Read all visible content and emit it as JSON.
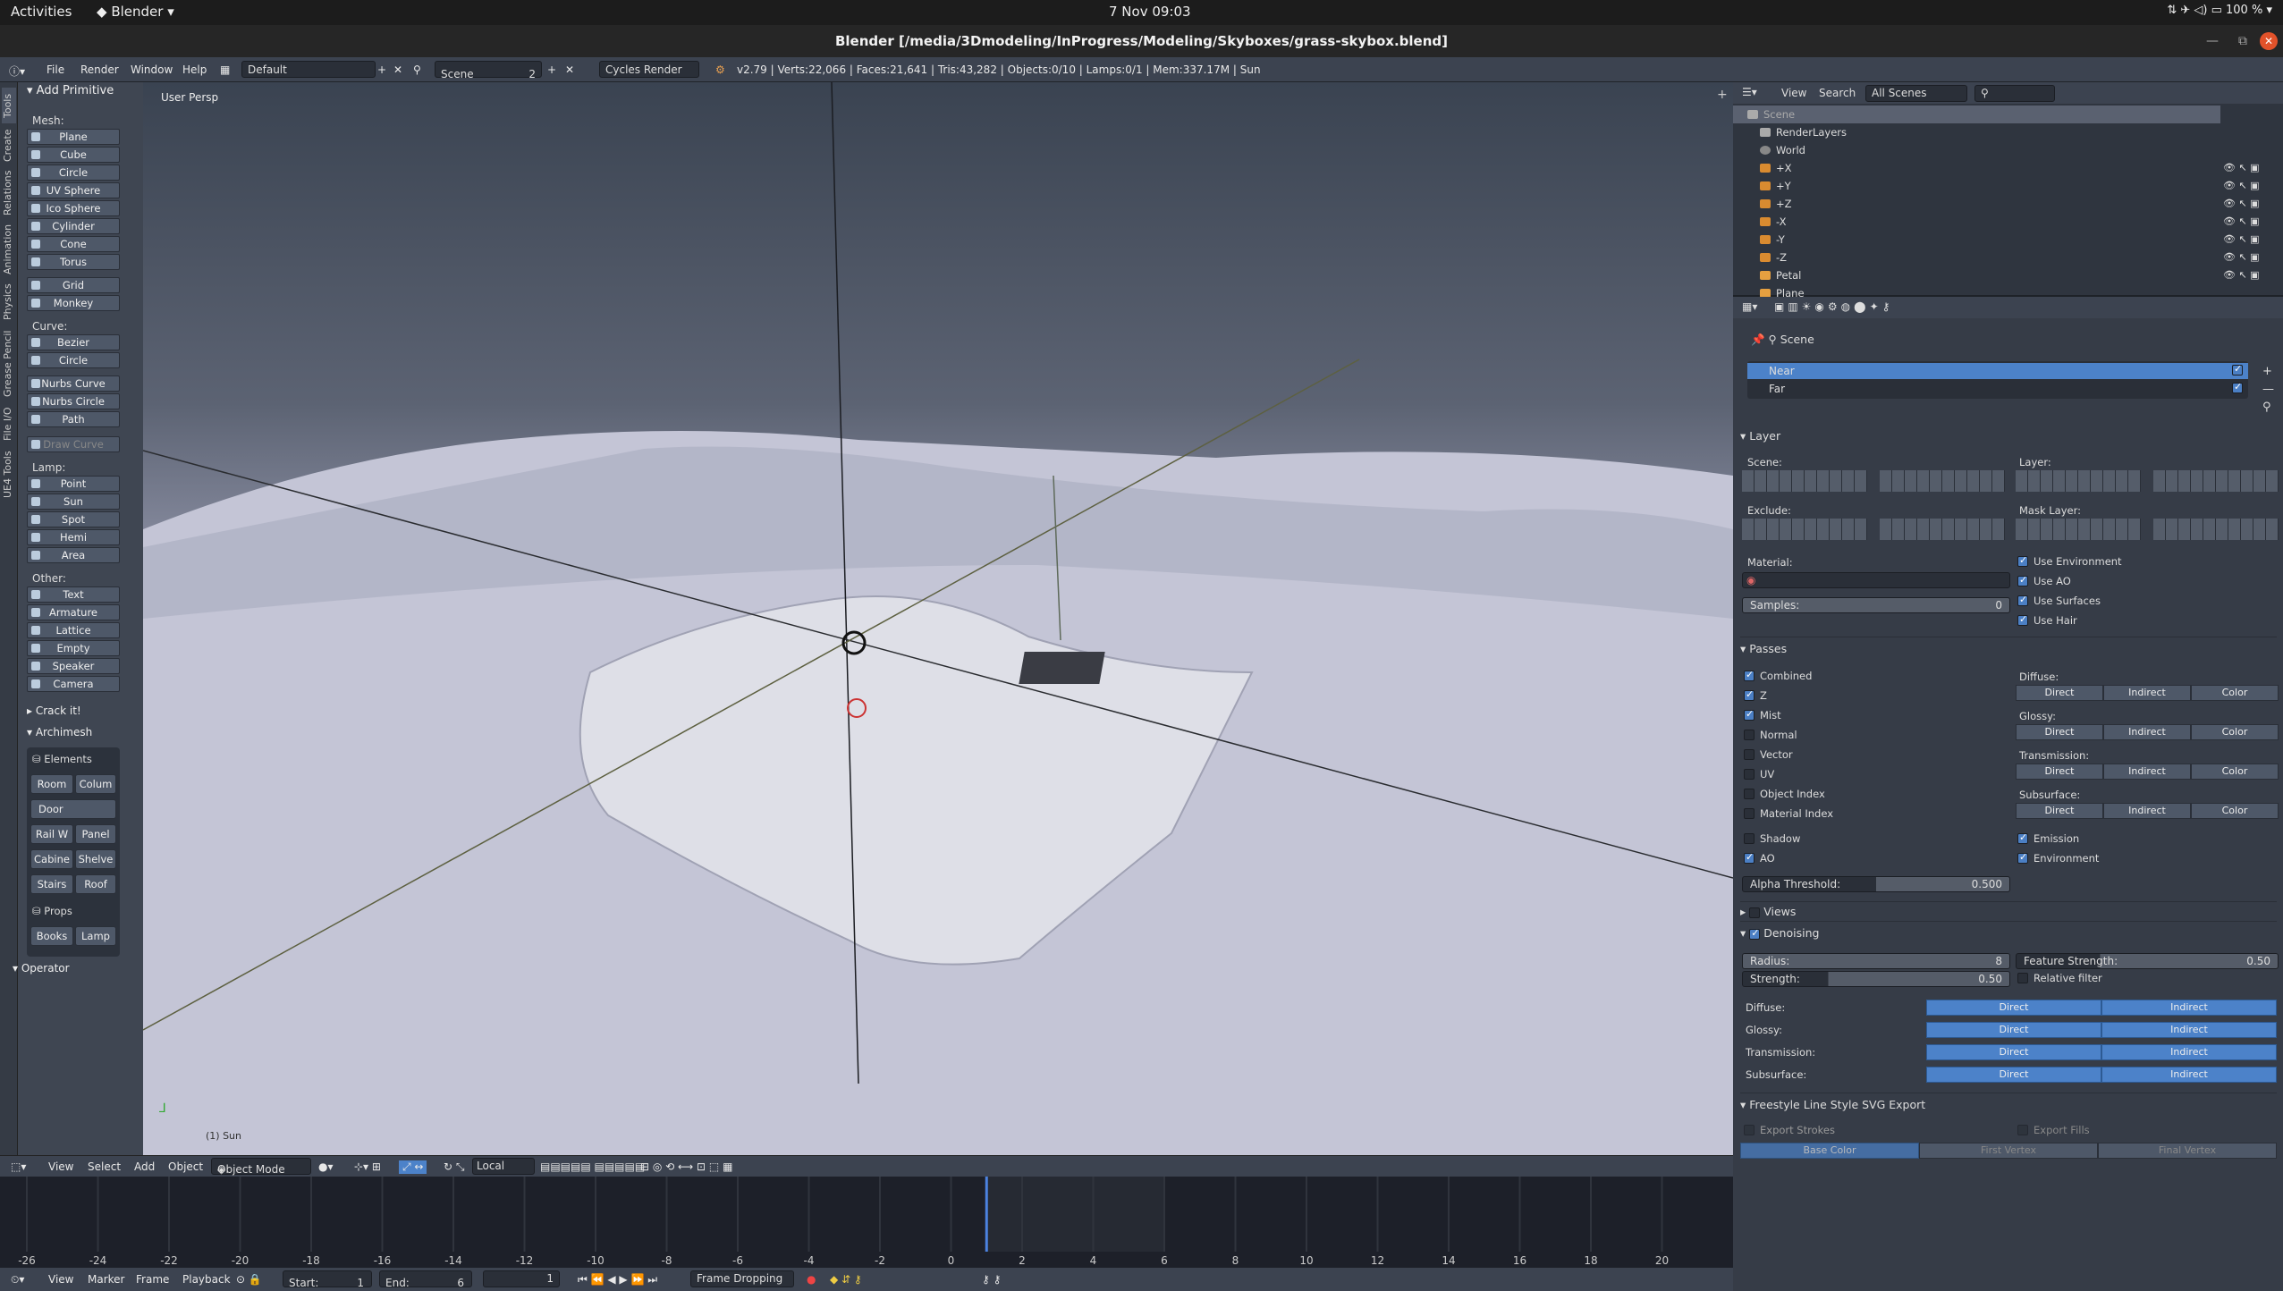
{
  "topbar": {
    "activities": "Activities",
    "app": "Blender",
    "clock": "7 Nov  09:03",
    "battery": "100 %"
  },
  "window_title": "Blender [/media/3Dmodeling/InProgress/Modeling/Skyboxes/grass-skybox.blend]",
  "menubar": {
    "menus": [
      "File",
      "Render",
      "Window",
      "Help"
    ],
    "layout": "Default",
    "scene": "Scene",
    "scene_count": "2",
    "engine": "Cycles Render",
    "stats": "v2.79 | Verts:22,066 | Faces:21,641 | Tris:43,282 | Objects:0/10 | Lamps:0/1 | Mem:337.17M | Sun"
  },
  "vtabs": [
    "Tools",
    "Create",
    "Relations",
    "Animation",
    "Physics",
    "Grease Pencil",
    "File I/O",
    "UE4 Tools"
  ],
  "tools": {
    "add_primitive": "Add Primitive",
    "mesh_label": "Mesh:",
    "mesh": [
      "Plane",
      "Cube",
      "Circle",
      "UV Sphere",
      "Ico Sphere",
      "Cylinder",
      "Cone",
      "Torus"
    ],
    "mesh2": [
      "Grid",
      "Monkey"
    ],
    "curve_label": "Curve:",
    "curve": [
      "Bezier",
      "Circle"
    ],
    "curve2": [
      "Nurbs Curve",
      "Nurbs Circle",
      "Path"
    ],
    "draw_curve": "Draw Curve",
    "lamp_label": "Lamp:",
    "lamp": [
      "Point",
      "Sun",
      "Spot",
      "Hemi",
      "Area"
    ],
    "other_label": "Other:",
    "other": [
      "Text",
      "Armature",
      "Lattice",
      "Empty",
      "Speaker",
      "Camera"
    ],
    "crackit": "Crack it!",
    "archimesh": "Archimesh",
    "elements": "Elements",
    "arch_buttons": [
      "Room",
      "Colum",
      "Door",
      "Rail W",
      "Panel",
      "Cabine",
      "Shelve",
      "Stairs",
      "Roof"
    ],
    "props": "Props",
    "props_buttons": [
      "Books",
      "Lamp"
    ],
    "operator": "Operator"
  },
  "viewport": {
    "title": "User Persp",
    "footer": "(1) Sun"
  },
  "vpheader": {
    "items": [
      "View",
      "Select",
      "Add",
      "Object"
    ],
    "mode": "Object Mode",
    "pivot": "Local"
  },
  "timeline": {
    "ticks": [
      "-26",
      "-24",
      "-22",
      "-20",
      "-18",
      "-16",
      "-14",
      "-12",
      "-10",
      "-8",
      "-6",
      "-4",
      "-2",
      "0",
      "2",
      "4",
      "6",
      "8",
      "10",
      "12",
      "14",
      "16",
      "18",
      "20"
    ],
    "current_frame": 1
  },
  "tlfoot": {
    "items": [
      "View",
      "Marker",
      "Frame",
      "Playback"
    ],
    "start_label": "Start:",
    "start": "1",
    "end_label": "End:",
    "end": "6",
    "frame": "1",
    "sync": "Frame Dropping"
  },
  "outliner": {
    "view": "View",
    "search": "Search",
    "filter": "All Scenes",
    "rows": [
      "Scene",
      "RenderLayers",
      "World",
      "+X",
      "+Y",
      "+Z",
      "-X",
      "-Y",
      "-Z",
      "Petal",
      "Plane"
    ]
  },
  "props": {
    "breadcrumb": "Scene",
    "layers": [
      "Near",
      "Far"
    ],
    "layer_hdr": "Layer",
    "scene_lbl": "Scene:",
    "layer_lbl": "Layer:",
    "exclude_lbl": "Exclude:",
    "mask_lbl": "Mask Layer:",
    "material_lbl": "Material:",
    "samples_lbl": "Samples:",
    "samples": "0",
    "use": [
      "Use Environment",
      "Use AO",
      "Use Surfaces",
      "Use Hair"
    ],
    "passes_hdr": "Passes",
    "passes_left": [
      {
        "label": "Combined",
        "on": true
      },
      {
        "label": "Z",
        "on": true
      },
      {
        "label": "Mist",
        "on": true
      },
      {
        "label": "Normal",
        "on": false
      },
      {
        "label": "Vector",
        "on": false
      },
      {
        "label": "UV",
        "on": false
      },
      {
        "label": "Object Index",
        "on": false
      },
      {
        "label": "Material Index",
        "on": false
      }
    ],
    "pass_groups": [
      "Diffuse:",
      "Glossy:",
      "Transmission:",
      "Subsurface:"
    ],
    "dic": [
      "Direct",
      "Indirect",
      "Color"
    ],
    "shadow": "Shadow",
    "ao": "AO",
    "emission": "Emission",
    "environment": "Environment",
    "alpha_lbl": "Alpha Threshold:",
    "alpha": "0.500",
    "views_hdr": "Views",
    "denoise_hdr": "Denoising",
    "radius_lbl": "Radius:",
    "radius": "8",
    "feature_lbl": "Feature Strength:",
    "feature": "0.50",
    "strength_lbl": "Strength:",
    "strength": "0.50",
    "relative": "Relative filter",
    "den_rows": [
      "Diffuse:",
      "Glossy:",
      "Transmission:",
      "Subsurface:"
    ],
    "direct": "Direct",
    "indirect": "Indirect",
    "freestyle_hdr": "Freestyle Line Style SVG Export",
    "export_strokes": "Export Strokes",
    "export_fills": "Export Fills",
    "color_tabs": [
      "Base Color",
      "First Vertex",
      "Final Vertex"
    ]
  }
}
